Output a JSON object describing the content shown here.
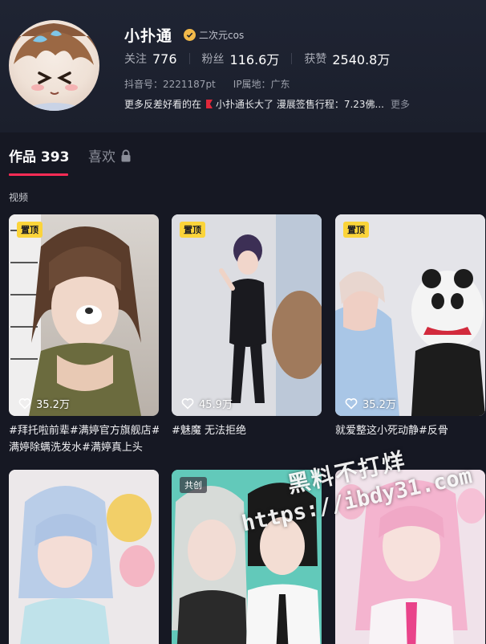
{
  "profile": {
    "name": "小扑通",
    "verify_text": "二次元cos",
    "stats": [
      {
        "label": "关注",
        "value": "776"
      },
      {
        "label": "粉丝",
        "value": "116.6万"
      },
      {
        "label": "获赞",
        "value": "2540.8万"
      }
    ],
    "douyin_id": "抖音号：2221187pt",
    "ip_location": "IP属地：广东",
    "bio_before": "更多反差好看的在",
    "bio_after": "小扑通长大了 漫展签售行程：7.23佛...",
    "bio_more": "更多"
  },
  "tabs": [
    {
      "label": "作品 393"
    },
    {
      "label": "喜欢"
    }
  ],
  "section_label": "视频",
  "videos": [
    {
      "badge": "置顶",
      "likes": "35.2万",
      "caption": "#拜托啦前辈#满婷官方旗舰店#满婷除螨洗发水#满婷真上头"
    },
    {
      "badge": "置顶",
      "likes": "45.9万",
      "caption": "#魅魔 无法拒绝"
    },
    {
      "badge": "置顶",
      "likes": "35.2万",
      "caption": "就爱整这小死动静#反骨"
    },
    {
      "badge": "",
      "likes": "",
      "caption": ""
    },
    {
      "badge": "共创",
      "likes": "",
      "caption": ""
    },
    {
      "badge": "",
      "likes": "",
      "caption": ""
    }
  ],
  "watermark": {
    "line1": "黑料不打烊",
    "line2": "https://ibdy31.com"
  },
  "colors": {
    "background": "#161823",
    "accent": "#fe2c55",
    "pin_badge": "#fbd43a",
    "verify_badge": "#f2b94a"
  }
}
